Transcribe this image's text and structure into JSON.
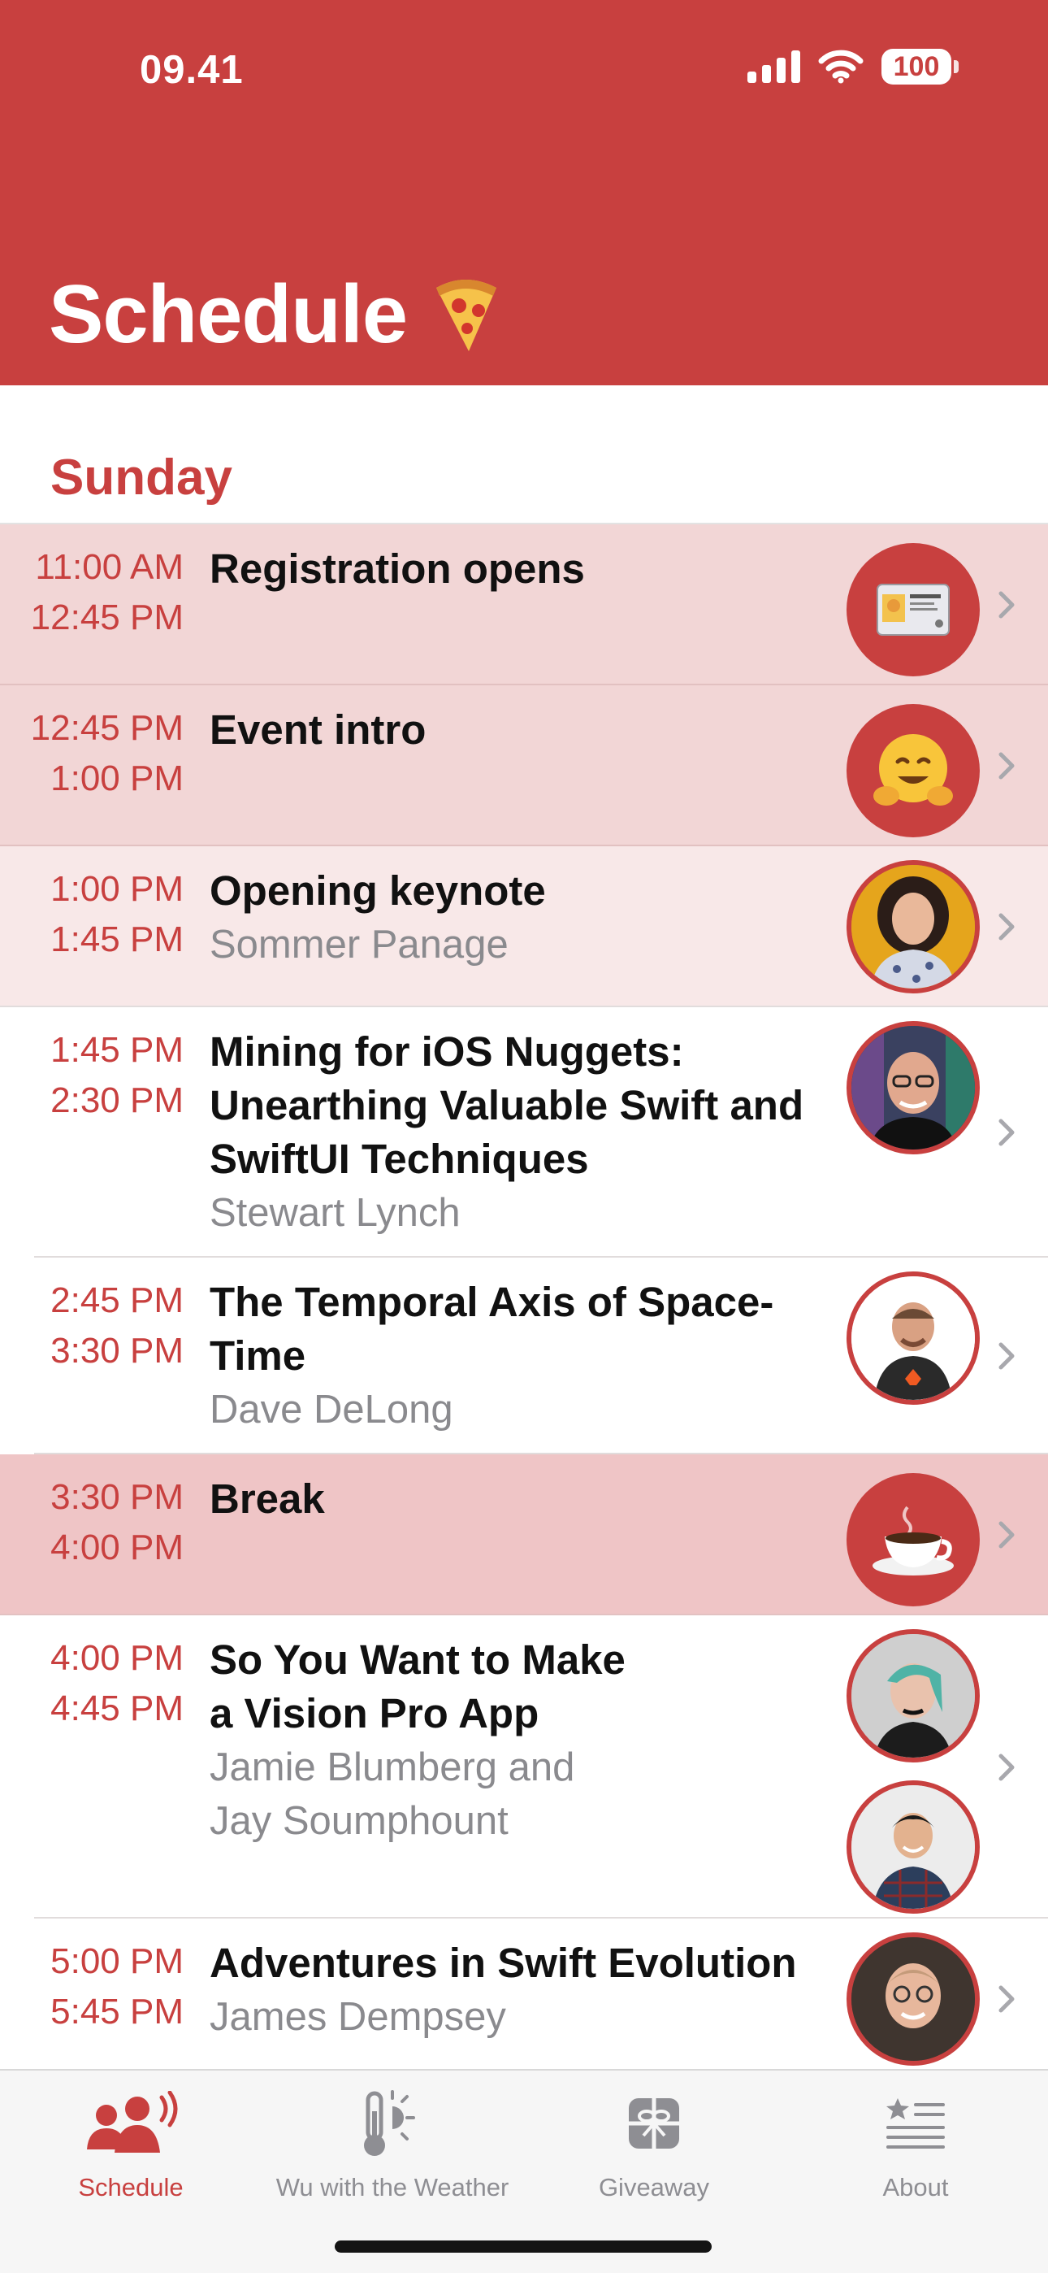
{
  "status_bar": {
    "time": "09.41",
    "battery": "100"
  },
  "header": {
    "title": "Schedule",
    "emoji": "🍕",
    "color": "#c8403f"
  },
  "section": {
    "title": "Sunday"
  },
  "sessions": [
    {
      "start": "11:00 AM",
      "end": "12:45 PM",
      "title": "Registration opens",
      "speaker": "",
      "avatars": [
        "id-card-emoji"
      ]
    },
    {
      "start": "12:45 PM",
      "end": "1:00 PM",
      "title": "Event intro",
      "speaker": "",
      "avatars": [
        "hugging-face-emoji"
      ]
    },
    {
      "start": "1:00 PM",
      "end": "1:45 PM",
      "title": "Opening keynote",
      "speaker": "Sommer Panage",
      "avatars": [
        "speaker-photo"
      ]
    },
    {
      "start": "1:45 PM",
      "end": "2:30 PM",
      "title": "Mining for iOS Nuggets: Unearthing Valuable Swift and SwiftUI Techniques",
      "speaker": "Stewart Lynch",
      "avatars": [
        "speaker-photo"
      ]
    },
    {
      "start": "2:45 PM",
      "end": "3:30 PM",
      "title": "The Temporal Axis of Space-Time",
      "speaker": "Dave DeLong",
      "avatars": [
        "speaker-photo"
      ]
    },
    {
      "start": "3:30 PM",
      "end": "4:00 PM",
      "title": "Break",
      "speaker": "",
      "avatars": [
        "coffee-emoji"
      ]
    },
    {
      "start": "4:00 PM",
      "end": "4:45 PM",
      "title": "So You Want to Make a Vision Pro App",
      "speaker": "Jamie Blumberg and Jay Soumphount",
      "avatars": [
        "speaker-photo",
        "speaker-photo"
      ]
    },
    {
      "start": "5:00 PM",
      "end": "5:45 PM",
      "title": "Adventures in Swift Evolution",
      "speaker": "James Dempsey",
      "avatars": [
        "speaker-photo"
      ]
    }
  ],
  "tabs": [
    {
      "label": "Schedule",
      "icon": "people-broadcast-icon",
      "active": true
    },
    {
      "label": "Wu with the Weather",
      "icon": "thermometer-sun-icon",
      "active": false
    },
    {
      "label": "Giveaway",
      "icon": "gift-icon",
      "active": false
    },
    {
      "label": "About",
      "icon": "list-star-icon",
      "active": false
    }
  ],
  "colors": {
    "accent": "#c8403f",
    "admin_row": "#f2d6d6",
    "keynote_row": "#f8e8e8",
    "break_row": "#efc5c6",
    "speaker_text": "#8a8a8e"
  }
}
